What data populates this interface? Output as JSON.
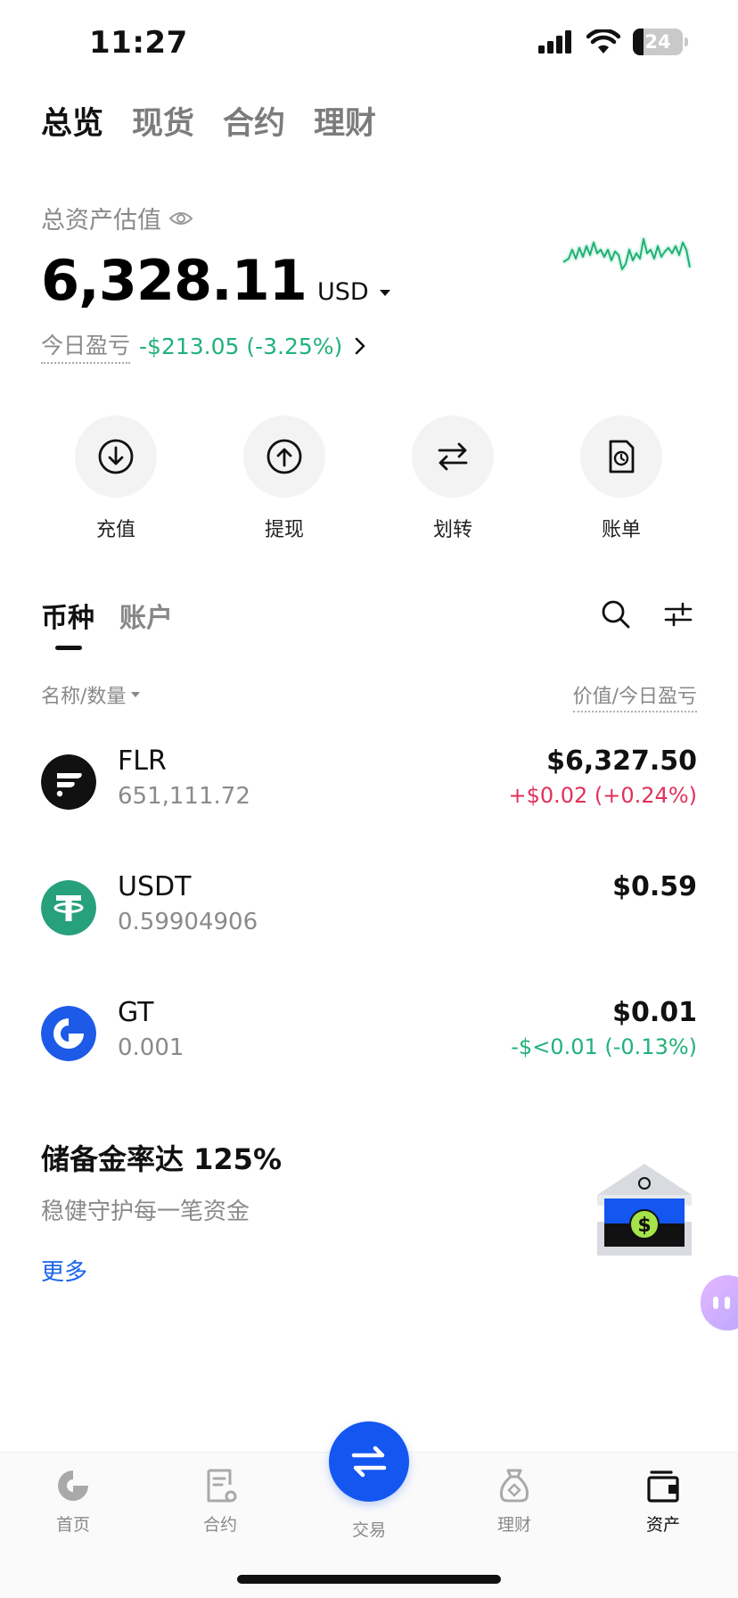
{
  "status_bar": {
    "time": "11:27",
    "battery": "24"
  },
  "top_tabs": [
    {
      "label": "总览",
      "active": true
    },
    {
      "label": "现货",
      "active": false
    },
    {
      "label": "合约",
      "active": false
    },
    {
      "label": "理财",
      "active": false
    }
  ],
  "summary": {
    "label": "总资产估值",
    "value": "6,328.11",
    "currency": "USD",
    "pnl_label": "今日盈亏",
    "pnl_value": "-$213.05 (-3.25%)"
  },
  "actions": [
    {
      "label": "充值",
      "icon": "deposit-icon"
    },
    {
      "label": "提现",
      "icon": "withdraw-icon"
    },
    {
      "label": "划转",
      "icon": "transfer-icon"
    },
    {
      "label": "账单",
      "icon": "bill-icon"
    }
  ],
  "coin_tabs": [
    {
      "label": "币种",
      "active": true
    },
    {
      "label": "账户",
      "active": false
    }
  ],
  "columns": {
    "left": "名称/数量",
    "right": "价值/今日盈亏"
  },
  "coins": [
    {
      "symbol": "FLR",
      "quantity": "651,111.72",
      "value": "$6,327.50",
      "pnl": "+$0.02 (+0.24%)",
      "pnl_color": "#e0315b"
    },
    {
      "symbol": "USDT",
      "quantity": "0.59904906",
      "value": "$0.59",
      "pnl": "",
      "pnl_color": "#21b27b"
    },
    {
      "symbol": "GT",
      "quantity": "0.001",
      "value": "$0.01",
      "pnl": "-$<0.01 (-0.13%)",
      "pnl_color": "#21b27b"
    }
  ],
  "reserve": {
    "title": "储备金率达 125%",
    "subtitle": "稳健守护每一笔资金",
    "more": "更多"
  },
  "bottom_nav": [
    {
      "label": "首页",
      "icon": "home-icon",
      "active": false
    },
    {
      "label": "合约",
      "icon": "contract-icon",
      "active": false
    },
    {
      "label": "交易",
      "icon": "trade-icon",
      "active": false
    },
    {
      "label": "理财",
      "icon": "finance-icon",
      "active": false
    },
    {
      "label": "资产",
      "icon": "wallet-icon",
      "active": true
    }
  ],
  "colors": {
    "accent": "#1456f0",
    "gain_green": "#21b27b",
    "loss_red": "#e0315b",
    "link": "#1a63ee"
  }
}
